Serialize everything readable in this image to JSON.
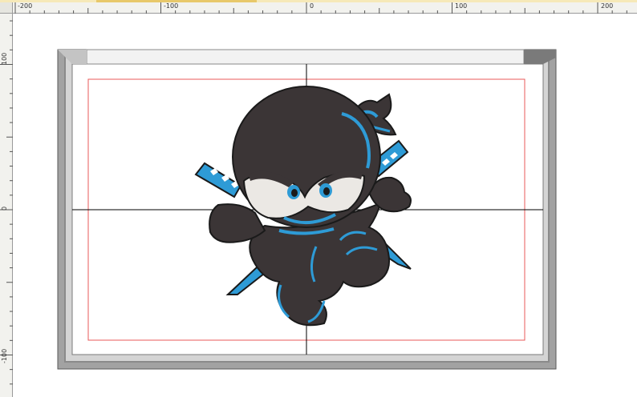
{
  "rulers": {
    "horizontal_labels": [
      "-200",
      "-100",
      "0",
      "100",
      "200"
    ],
    "vertical_labels": [
      "100",
      "0",
      "-100"
    ]
  },
  "hoop": {
    "frame_color": "#9a9a9a",
    "frame_dark": "#6e6e6e",
    "safe_area_color": "#e85a5a",
    "crosshair_color": "#000000"
  },
  "design": {
    "subject": "ninja embroidery design",
    "colors": {
      "body": "#3b3536",
      "accent": "#2e9bd6",
      "eye_white": "#ebe8e4",
      "blade": "#4aa6dc"
    }
  }
}
